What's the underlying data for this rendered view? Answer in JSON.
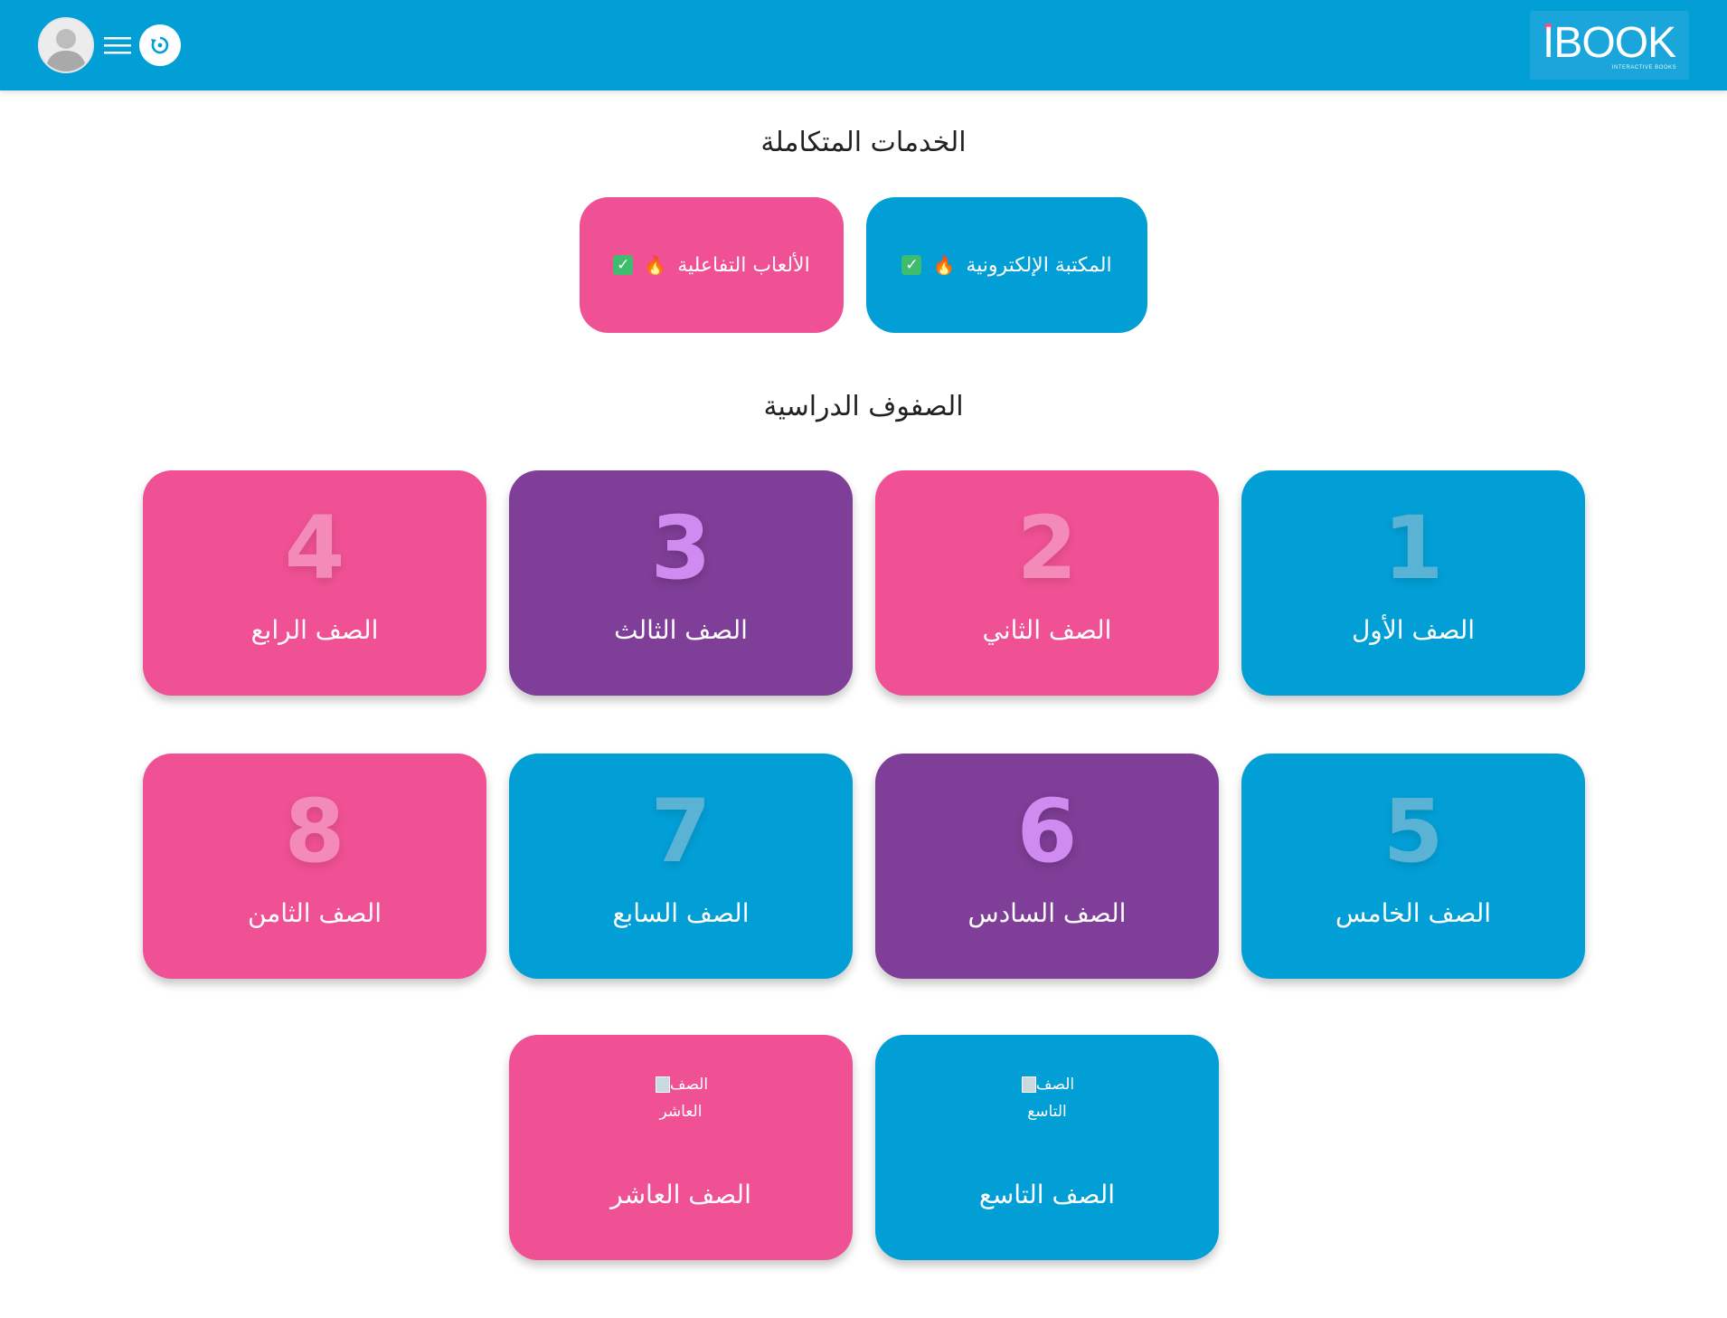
{
  "header": {
    "logo_text": "IBOOK",
    "logo_subtitle": "INTERACTIVE BOOKS"
  },
  "icons": {
    "avatar": "user-avatar",
    "menu": "hamburger-menu-icon",
    "refresh": "refresh-icon",
    "fire": "fire-icon",
    "check": "check-mark-icon"
  },
  "colors": {
    "header_blue": "#029fd7",
    "pink": "#f05194",
    "purple": "#7f3e97"
  },
  "services": {
    "title": "الخدمات المتكاملة",
    "library": {
      "label": "المكتبة الإلكترونية",
      "fire": "🔥",
      "check": "✓"
    },
    "games": {
      "label": "الألعاب التفاعلية",
      "fire": "🔥",
      "check": "✓"
    }
  },
  "grades": {
    "title": "الصفوف الدراسية",
    "items": [
      {
        "number": "1",
        "label": "الصف الأول"
      },
      {
        "number": "2",
        "label": "الصف الثاني"
      },
      {
        "number": "3",
        "label": "الصف الثالث"
      },
      {
        "number": "4",
        "label": "الصف الرابع"
      },
      {
        "number": "5",
        "label": "الصف الخامس"
      },
      {
        "number": "6",
        "label": "الصف السادس"
      },
      {
        "number": "7",
        "label": "الصف السابع"
      },
      {
        "number": "8",
        "label": "الصف الثامن"
      },
      {
        "number": "",
        "label": "الصف التاسع",
        "img_alt_1": "الصف",
        "img_alt_2": "التاسع"
      },
      {
        "number": "",
        "label": "الصف العاشر",
        "img_alt_1": "الصف",
        "img_alt_2": "العاشر"
      }
    ]
  }
}
